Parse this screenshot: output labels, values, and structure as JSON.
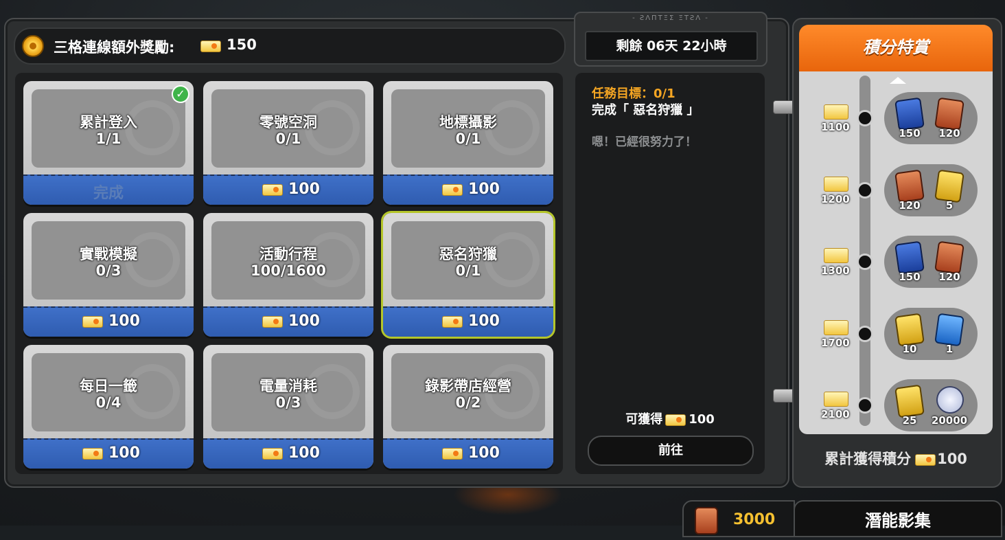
{
  "header": {
    "bonus_label": "三格連線額外獎勵:",
    "bonus_value": "150",
    "timer": "剩餘 06天 22小時",
    "timer_decor": "- ƧΛΠΤΞΣ ΞΤƧΛ -"
  },
  "cards": [
    {
      "name": "累計登入",
      "progress": "1/1",
      "reward": "100",
      "status": "完成",
      "completed": true
    },
    {
      "name": "零號空洞",
      "progress": "0/1",
      "reward": "100"
    },
    {
      "name": "地標攝影",
      "progress": "0/1",
      "reward": "100"
    },
    {
      "name": "實戰模擬",
      "progress": "0/3",
      "reward": "100"
    },
    {
      "name": "活動行程",
      "progress": "100/1600",
      "reward": "100"
    },
    {
      "name": "惡名狩獵",
      "progress": "0/1",
      "reward": "100",
      "selected": true
    },
    {
      "name": "每日一籤",
      "progress": "0/4",
      "reward": "100"
    },
    {
      "name": "電量消耗",
      "progress": "0/3",
      "reward": "100"
    },
    {
      "name": "錄影帶店經營",
      "progress": "0/2",
      "reward": "100"
    }
  ],
  "detail": {
    "goal": "任務目標：0/1",
    "desc": "完成「 惡名狩獵 」",
    "flavor": "嗯！已經很努力了！",
    "obtain_label": "可獲得",
    "obtain_value": "100",
    "go_button": "前往"
  },
  "rewards_panel": {
    "title": "積分特賞",
    "tiers": [
      {
        "points": "1100",
        "items": [
          {
            "icon": "blue-book-icon",
            "count": "150"
          },
          {
            "icon": "red-book-icon",
            "count": "120"
          }
        ]
      },
      {
        "points": "1200",
        "items": [
          {
            "icon": "red-book-icon",
            "count": "120"
          },
          {
            "icon": "gold-chip-icon",
            "count": "5"
          }
        ]
      },
      {
        "points": "1300",
        "items": [
          {
            "icon": "blue-book-icon",
            "count": "150"
          },
          {
            "icon": "red-book-icon",
            "count": "120"
          }
        ]
      },
      {
        "points": "1700",
        "items": [
          {
            "icon": "gold-chip-icon",
            "count": "10"
          },
          {
            "icon": "blue-card-icon",
            "count": "1"
          }
        ]
      },
      {
        "points": "2100",
        "items": [
          {
            "icon": "gold-chip-icon",
            "count": "25"
          },
          {
            "icon": "silver-coin-icon",
            "count": "20000"
          }
        ]
      }
    ],
    "total_label": "累計獲得積分",
    "total_value": "100"
  },
  "bottom": {
    "currency_value": "3000",
    "tab_label": "潛能影集"
  },
  "colors": {
    "accent": "#f5a623",
    "header_orange": "#ff8a2a",
    "card_blue": "#3f70c8",
    "selected_border": "#b5c62a"
  }
}
